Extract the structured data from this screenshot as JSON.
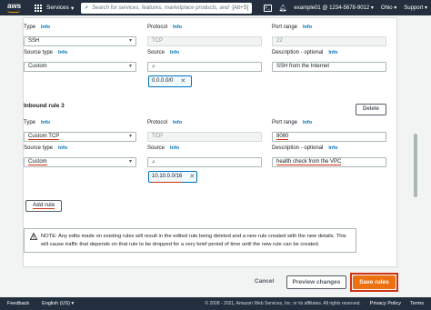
{
  "topnav": {
    "logo": "aws",
    "services": "Services",
    "search_placeholder": "Search for services, features, marketplace products, and",
    "search_kbd": "[Alt+S]",
    "account": "example01 @ 1234-5678-9012",
    "region": "Ohio",
    "support": "Support"
  },
  "rule2": {
    "type_label": "Type",
    "type_info": "Info",
    "type_value": "SSH",
    "protocol_label": "Protocol",
    "protocol_info": "Info",
    "protocol_value": "TCP",
    "port_label": "Port range",
    "port_info": "Info",
    "port_value": "22",
    "source_type_label": "Source type",
    "source_type_info": "Info",
    "source_type_value": "Custom",
    "source_label": "Source",
    "source_info": "Info",
    "source_chip": "0.0.0.0/0",
    "desc_label": "Description - optional",
    "desc_info": "Info",
    "desc_value": "SSH from the Internet"
  },
  "rule3": {
    "title": "Inbound rule 3",
    "delete": "Delete",
    "type_label": "Type",
    "type_info": "Info",
    "type_value": "Custom TCP",
    "protocol_label": "Protocol",
    "protocol_info": "Info",
    "protocol_value": "TCP",
    "port_label": "Port range",
    "port_info": "Info",
    "port_value": "8080",
    "source_type_label": "Source type",
    "source_type_info": "Info",
    "source_type_value": "Custom",
    "source_label": "Source",
    "source_info": "Info",
    "source_chip": "10.10.0.0/16",
    "desc_label": "Description - optional",
    "desc_info": "Info",
    "desc_value": "health check from the VPC"
  },
  "add_rule": "Add rule",
  "warning": "NOTE: Any edits made on existing rules will result in the edited rule being deleted and a new rule created with the new details. This will cause traffic that depends on that rule to be dropped for a very brief period of time until the new rule can be created.",
  "actions": {
    "cancel": "Cancel",
    "preview": "Preview changes",
    "save": "Save rules"
  },
  "footer": {
    "feedback": "Feedback",
    "language": "English (US)",
    "copyright": "© 2008 - 2021, Amazon Web Services, Inc. or its affiliates. All rights reserved.",
    "privacy": "Privacy Policy",
    "terms": "Terms"
  },
  "colors": {
    "nav_bg": "#232f3e",
    "accent_orange": "#ec7211",
    "link_blue": "#0073bb",
    "highlight_red": "#d13212"
  }
}
